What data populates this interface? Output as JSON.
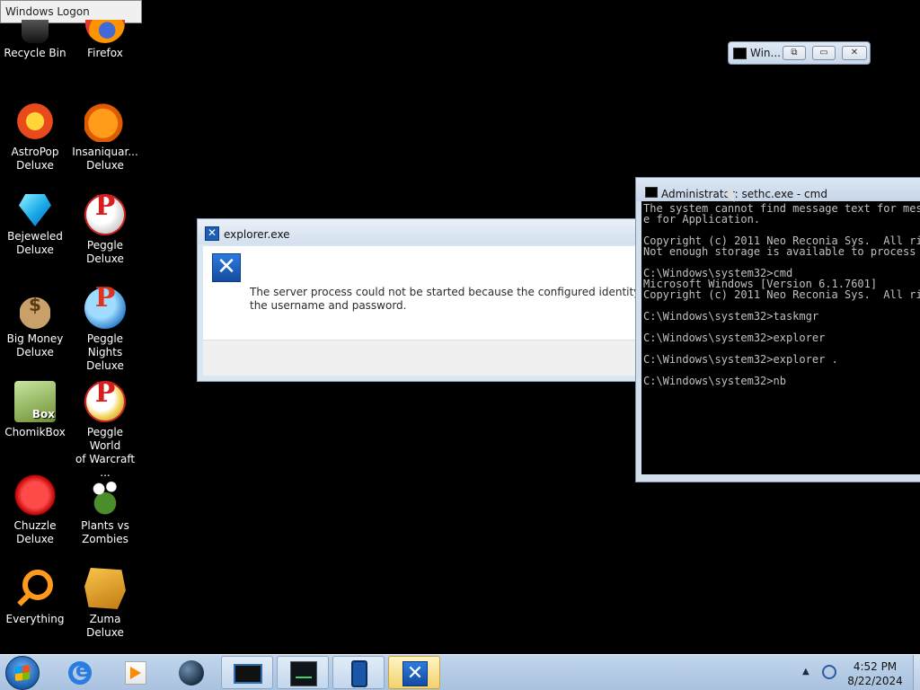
{
  "logon_window": {
    "title": "Windows Logon"
  },
  "desktop_icons": [
    {
      "label": "Recycle Bin",
      "icon": "recycle-bin-icon"
    },
    {
      "label": "Firefox",
      "icon": "firefox-icon"
    },
    {
      "label": "AstroPop\nDeluxe",
      "icon": "astropop-icon"
    },
    {
      "label": "Insaniquar...\nDeluxe",
      "icon": "insaniquarium-icon"
    },
    {
      "label": "Bejeweled\nDeluxe",
      "icon": "bejeweled-gem-icon"
    },
    {
      "label": "Peggle Deluxe",
      "icon": "peggle-icon"
    },
    {
      "label": "Big Money\nDeluxe",
      "icon": "money-bag-icon"
    },
    {
      "label": "Peggle Nights\nDeluxe",
      "icon": "peggle-nights-icon"
    },
    {
      "label": "ChomikBox",
      "icon": "chomikbox-icon"
    },
    {
      "label": "Peggle World\nof Warcraft ...",
      "icon": "peggle-warcraft-icon"
    },
    {
      "label": "Chuzzle\nDeluxe",
      "icon": "chuzzle-icon"
    },
    {
      "label": "Plants vs\nZombies",
      "icon": "plants-vs-zombies-icon"
    },
    {
      "label": "Everything",
      "icon": "everything-search-icon"
    },
    {
      "label": "Zuma Deluxe",
      "icon": "zuma-icon"
    }
  ],
  "minimized_window": {
    "title": "Win..."
  },
  "error_dialog": {
    "title": "explorer.exe",
    "message_line1": "The server process could not be started because the configured identity is incorrect. Check",
    "message_line2": "the username and password."
  },
  "cmd_window": {
    "title": "Administrator: sethc.exe - cmd",
    "console_text": "The system cannot find message text for message\ne for Application.\n\nCopyright (c) 2011 Neo Reconia Sys.  All rights\nNot enough storage is available to process this\n\nC:\\Windows\\system32>cmd\nMicrosoft Windows [Version 6.1.7601]\nCopyright (c) 2011 Neo Reconia Sys.  All rights\n\nC:\\Windows\\system32>taskmgr\n\nC:\\Windows\\system32>explorer\n\nC:\\Windows\\system32>explorer .\n\nC:\\Windows\\system32>nb"
  },
  "taskbar": {
    "start_icon": "windows-start-orb-icon",
    "items": [
      {
        "icon": "internet-explorer-icon",
        "state": "pinned"
      },
      {
        "icon": "media-player-icon",
        "state": "pinned"
      },
      {
        "icon": "globe-app-icon",
        "state": "pinned"
      },
      {
        "icon": "cmd-window-icon",
        "state": "running"
      },
      {
        "icon": "task-manager-icon",
        "state": "running"
      },
      {
        "icon": "tablet-icon",
        "state": "running"
      },
      {
        "icon": "error-x-icon",
        "state": "active"
      }
    ],
    "clock_time": "4:52 PM",
    "clock_date": "8/22/2024"
  }
}
